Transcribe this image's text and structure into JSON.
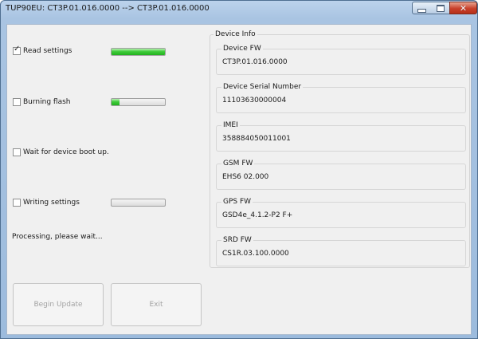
{
  "window": {
    "title": "TUP90EU: CT3P.01.016.0000  -->  CT3P.01.016.0000",
    "close_glyph": "✕"
  },
  "steps": [
    {
      "label": "Read settings",
      "checked": true,
      "progress": 1.0,
      "has_bar": true
    },
    {
      "label": "Burning flash",
      "checked": false,
      "progress": 0.15,
      "has_bar": true
    },
    {
      "label": "Wait for device boot up.",
      "checked": false,
      "progress": null,
      "has_bar": false
    },
    {
      "label": "Writing settings",
      "checked": false,
      "progress": 0.0,
      "has_bar": true
    }
  ],
  "check_glyph": "✓",
  "status_text": "Processing, please wait...",
  "buttons": {
    "begin_update": "Begin Update",
    "exit": "Exit"
  },
  "device_info": {
    "title": "Device Info",
    "fields": [
      {
        "label": "Device FW",
        "value": "CT3P.01.016.0000"
      },
      {
        "label": "Device Serial Number",
        "value": "11103630000004"
      },
      {
        "label": "IMEI",
        "value": "358884050011001"
      },
      {
        "label": "GSM FW",
        "value": "EHS6 02.000"
      },
      {
        "label": "GPS FW",
        "value": "GSD4e_4.1.2-P2 F+"
      },
      {
        "label": "SRD FW",
        "value": "CS1R.03.100.0000"
      }
    ]
  },
  "colors": {
    "progress_green": "#22b11f",
    "close_red": "#c8402a",
    "disabled_text": "#a3a3a3"
  }
}
